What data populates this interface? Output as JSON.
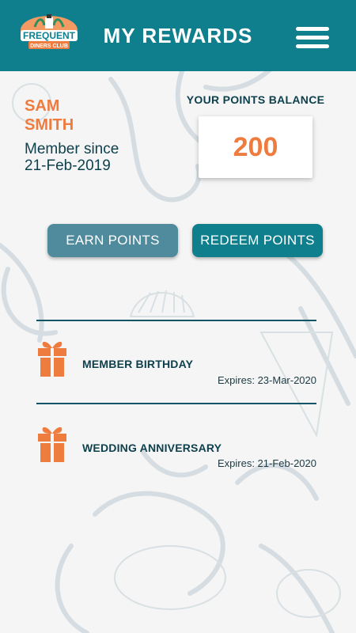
{
  "header": {
    "title": "MY REWARDS",
    "logo_text": {
      "top": "FREQUENT",
      "bottom": "DINERS CLUB"
    },
    "menu_icon": "hamburger-icon"
  },
  "member": {
    "first_name": "SAM",
    "last_name": "SMITH",
    "since_label": "Member since",
    "since_date": "21-Feb-2019"
  },
  "balance": {
    "label": "YOUR POINTS BALANCE",
    "value": "200"
  },
  "actions": {
    "earn_label": "EARN POINTS",
    "redeem_label": "REDEEM POINTS"
  },
  "rewards": [
    {
      "title": "MEMBER BIRTHDAY",
      "expires": "Expires: 23-Mar-2020",
      "icon": "gift-icon"
    },
    {
      "title": "WEDDING ANNIVERSARY",
      "expires": "Expires: 21-Feb-2020",
      "icon": "gift-icon"
    }
  ],
  "colors": {
    "header": "#0f7f8d",
    "accent_orange": "#ef7c3f",
    "text_dark": "#0d3f4d",
    "earn_button": "#4f8b9d",
    "redeem_button": "#0f7f8d"
  }
}
